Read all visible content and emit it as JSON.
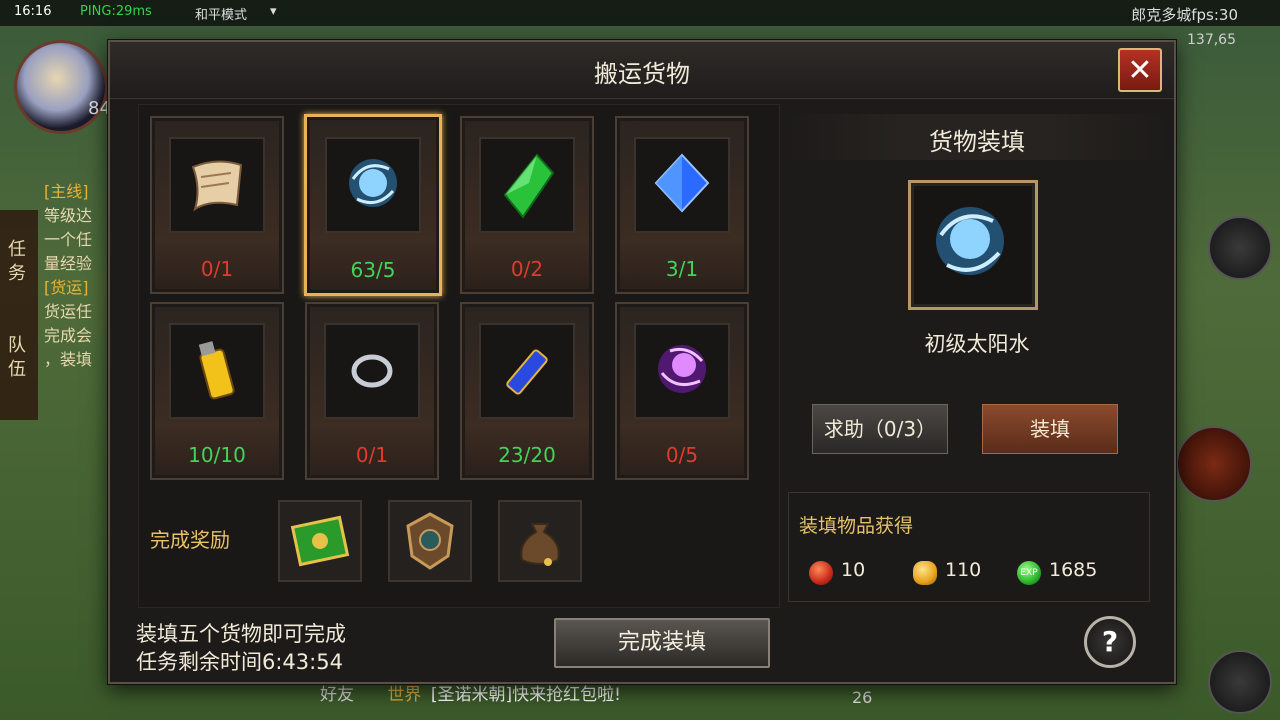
{
  "hud": {
    "time": "16:16",
    "ping": "PING:29ms",
    "mode": "和平模式",
    "fps": "郎克多城fps:30",
    "coord": "137,65",
    "level": "84",
    "side_tab_task": [
      "任",
      "务"
    ],
    "side_tab_team": [
      "队",
      "伍"
    ],
    "quest_lines": [
      "[主线]",
      "等级达",
      "一个任",
      "量经验",
      "[货运]",
      "货运任",
      "完成会",
      "，装填"
    ],
    "chat_friend": "好友",
    "chat_channel": "世界",
    "chat_text": "[圣诺米朝]快来抢红包啦!",
    "num26": "26"
  },
  "dialog": {
    "title": "搬运货物",
    "close_icon": "✕"
  },
  "cargo": {
    "items": [
      {
        "icon": "scroll-icon",
        "count": "0/1",
        "complete": false,
        "selected": false
      },
      {
        "icon": "blue-orb-icon",
        "count": "63/5",
        "complete": true,
        "selected": true
      },
      {
        "icon": "green-crystal-icon",
        "count": "0/2",
        "complete": false,
        "selected": false
      },
      {
        "icon": "blue-gem-icon",
        "count": "3/1",
        "complete": true,
        "selected": false
      },
      {
        "icon": "yellow-potion-icon",
        "count": "10/10",
        "complete": true,
        "selected": false
      },
      {
        "icon": "silver-ring-icon",
        "count": "0/1",
        "complete": false,
        "selected": false
      },
      {
        "icon": "blue-vial-icon",
        "count": "23/20",
        "complete": true,
        "selected": false
      },
      {
        "icon": "purple-orb-icon",
        "count": "0/5",
        "complete": false,
        "selected": false
      }
    ]
  },
  "reward": {
    "label": "完成奖励",
    "items": [
      "green-book-icon",
      "bronze-badge-icon",
      "money-bag-icon"
    ]
  },
  "hint": {
    "line1": "装填五个货物即可完成",
    "line2": "任务剩余时间6:43:54"
  },
  "complete_button": "完成装填",
  "loading": {
    "title": "货物装填",
    "item_name": "初级太阳水",
    "help_button": "求助（0/3）",
    "load_button": "装填"
  },
  "gain": {
    "title": "装填物品获得",
    "items": [
      {
        "icon": "red-orb-icon",
        "value": "10"
      },
      {
        "icon": "gold-coin-icon",
        "value": "110"
      },
      {
        "icon": "exp-icon",
        "value": "1685"
      }
    ]
  },
  "help_icon": "?",
  "colors": {
    "incomplete": "#e23a2e",
    "complete": "#42d35a",
    "gold_text": "#e6c26a",
    "selected_border": "#e7b356"
  }
}
